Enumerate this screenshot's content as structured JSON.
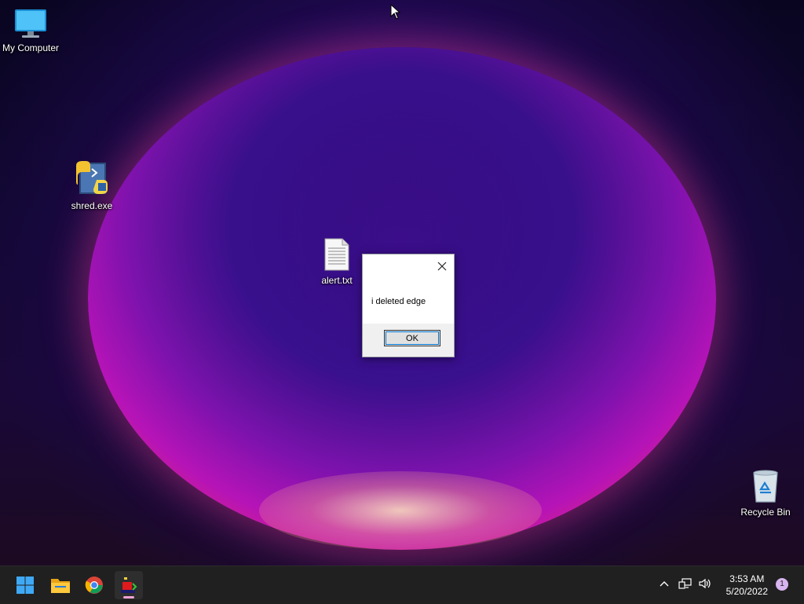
{
  "desktop": {
    "icons": [
      {
        "label": "My Computer"
      },
      {
        "label": "shred.exe"
      },
      {
        "label": "alert.txt"
      },
      {
        "label": "Recycle Bin"
      }
    ]
  },
  "dialog": {
    "message": "i deleted edge",
    "ok_label": "OK"
  },
  "taskbar": {
    "apps": [
      "start-icon",
      "file-explorer-icon",
      "chrome-icon",
      "app-icon"
    ],
    "clock": {
      "time": "3:53 AM",
      "date": "5/20/2022"
    },
    "notification_count": "1"
  }
}
